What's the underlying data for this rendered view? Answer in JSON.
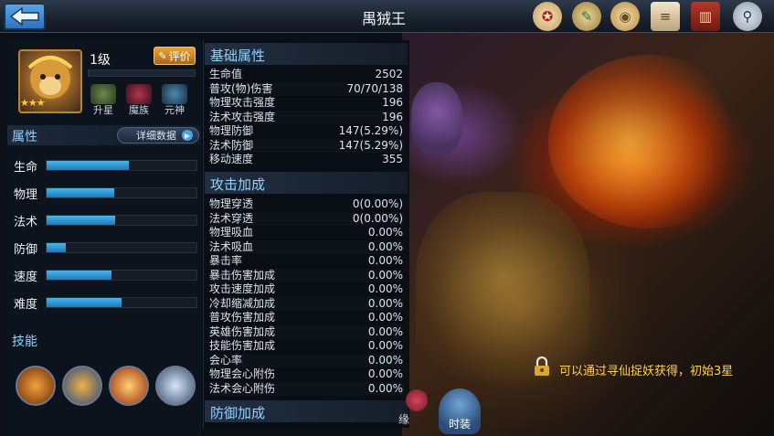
{
  "header": {
    "title": "禺狨王",
    "icons": [
      "seal-icon",
      "scroll-icon",
      "coin-icon",
      "paper-icon",
      "book-icon",
      "search-icon"
    ]
  },
  "hero": {
    "level": "1级",
    "stars": "★★★",
    "rate_label": "评价",
    "sub_buttons": [
      {
        "label": "升星"
      },
      {
        "label": "魔族"
      },
      {
        "label": "元神"
      }
    ]
  },
  "attributes": {
    "section_title": "属性",
    "detail_button": "详细数据",
    "stats": [
      {
        "label": "生命",
        "value": 0.55
      },
      {
        "label": "物理",
        "value": 0.45
      },
      {
        "label": "法术",
        "value": 0.46
      },
      {
        "label": "防御",
        "value": 0.13
      },
      {
        "label": "速度",
        "value": 0.43
      },
      {
        "label": "难度",
        "value": 0.5
      }
    ]
  },
  "skills": {
    "section_title": "技能",
    "items": [
      "fire-skill-icon",
      "armor-skill-icon",
      "slash-skill-icon",
      "whirlwind-skill-icon"
    ]
  },
  "basic": {
    "title": "基础属性",
    "rows": [
      {
        "label": "生命值",
        "value": "2502"
      },
      {
        "label": "普攻(物)伤害",
        "value": "70/70/138"
      },
      {
        "label": "物理攻击强度",
        "value": "196"
      },
      {
        "label": "法术攻击强度",
        "value": "196"
      },
      {
        "label": "物理防御",
        "value": "147(5.29%)"
      },
      {
        "label": "法术防御",
        "value": "147(5.29%)"
      },
      {
        "label": "移动速度",
        "value": "355"
      }
    ]
  },
  "attack": {
    "title": "攻击加成",
    "rows": [
      {
        "label": "物理穿透",
        "value": "0(0.00%)"
      },
      {
        "label": "法术穿透",
        "value": "0(0.00%)"
      },
      {
        "label": "物理吸血",
        "value": "0.00%"
      },
      {
        "label": "法术吸血",
        "value": "0.00%"
      },
      {
        "label": "暴击率",
        "value": "0.00%"
      },
      {
        "label": "暴击伤害加成",
        "value": "0.00%"
      },
      {
        "label": "攻击速度加成",
        "value": "0.00%"
      },
      {
        "label": "冷却缩减加成",
        "value": "0.00%"
      },
      {
        "label": "普攻伤害加成",
        "value": "0.00%"
      },
      {
        "label": "英雄伤害加成",
        "value": "0.00%"
      },
      {
        "label": "技能伤害加成",
        "value": "0.00%"
      },
      {
        "label": "会心率",
        "value": "0.00%"
      },
      {
        "label": "物理会心附伤",
        "value": "0.00%"
      },
      {
        "label": "法术会心附伤",
        "value": "0.00%"
      }
    ]
  },
  "defense": {
    "title": "防御加成"
  },
  "tabs": {
    "fate": "缘",
    "fashion": "时装"
  },
  "unlock_hint": "可以通过寻仙捉妖获得，初始3星"
}
